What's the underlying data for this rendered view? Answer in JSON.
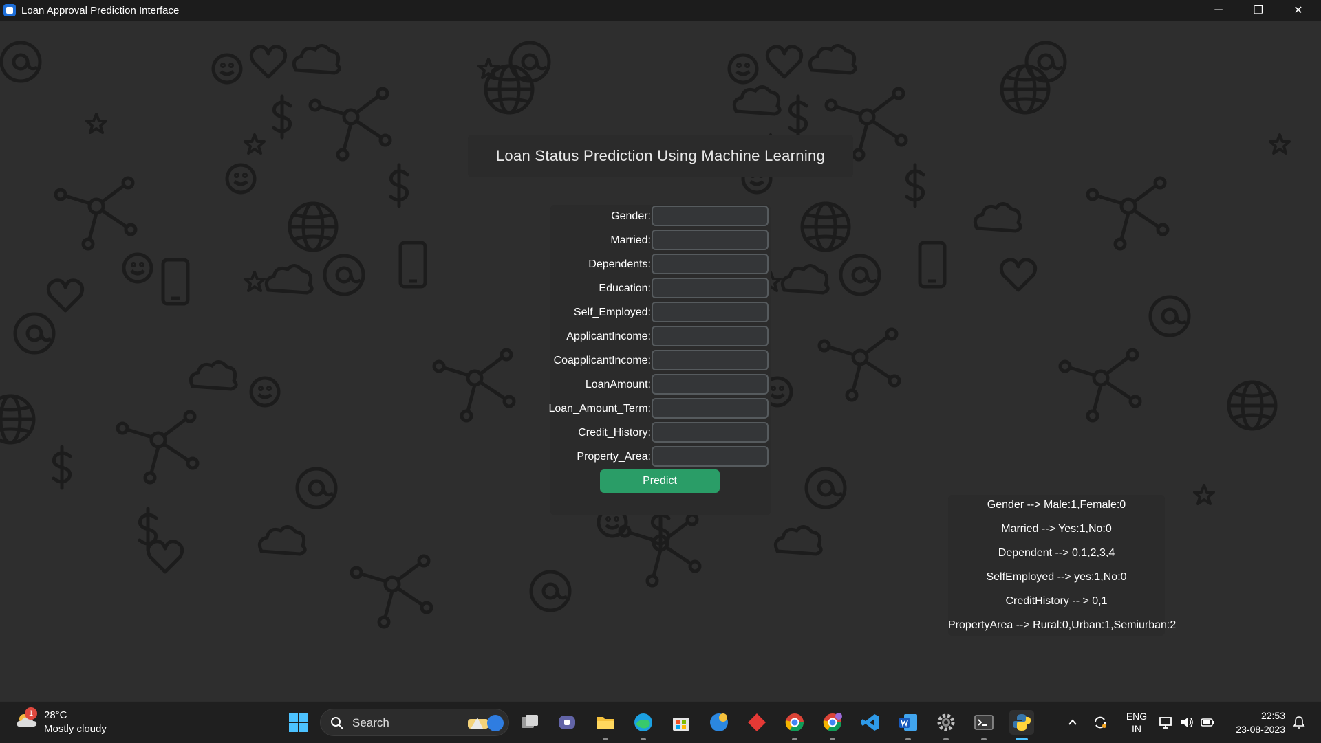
{
  "window": {
    "title": "Loan Approval Prediction Interface",
    "controls": {
      "minimize": "─",
      "maximize": "❐",
      "close": "✕"
    }
  },
  "heading": "Loan Status Prediction Using Machine Learning",
  "form": {
    "fields": [
      {
        "label": "Gender:",
        "value": ""
      },
      {
        "label": "Married:",
        "value": ""
      },
      {
        "label": "Dependents:",
        "value": ""
      },
      {
        "label": "Education:",
        "value": ""
      },
      {
        "label": "Self_Employed:",
        "value": ""
      },
      {
        "label": "ApplicantIncome:",
        "value": ""
      },
      {
        "label": "CoapplicantIncome:",
        "value": ""
      },
      {
        "label": "LoanAmount:",
        "value": ""
      },
      {
        "label": "Loan_Amount_Term:",
        "value": ""
      },
      {
        "label": "Credit_History:",
        "value": ""
      },
      {
        "label": "Property_Area:",
        "value": ""
      }
    ],
    "predict_label": "Predict"
  },
  "info": {
    "lines": [
      "Gender --> Male:1,Female:0",
      "Married --> Yes:1,No:0",
      "Dependent --> 0,1,2,3,4",
      "SelfEmployed --> yes:1,No:0",
      "CreditHistory -- > 0,1",
      "PropertyArea --> Rural:0,Urban:1,Semiurban:2"
    ]
  },
  "taskbar": {
    "weather": {
      "temp": "28°C",
      "condition": "Mostly cloudy",
      "badge": "1"
    },
    "search_label": "Search",
    "apps": [
      "start",
      "search",
      "task-view",
      "teams",
      "file-explorer",
      "edge",
      "store",
      "app-blue",
      "app-red",
      "chrome",
      "chrome-profile",
      "vscode",
      "word",
      "settings",
      "terminal",
      "python"
    ],
    "tray": {
      "language": "ENG",
      "region": "IN"
    },
    "clock": {
      "time": "22:53",
      "date": "23-08-2023"
    }
  },
  "colors": {
    "accent_button": "#2a9d67",
    "panel": "#2b2b2b",
    "input_bg": "#343638",
    "input_border": "#565b5e",
    "background": "#2e2e2e"
  }
}
